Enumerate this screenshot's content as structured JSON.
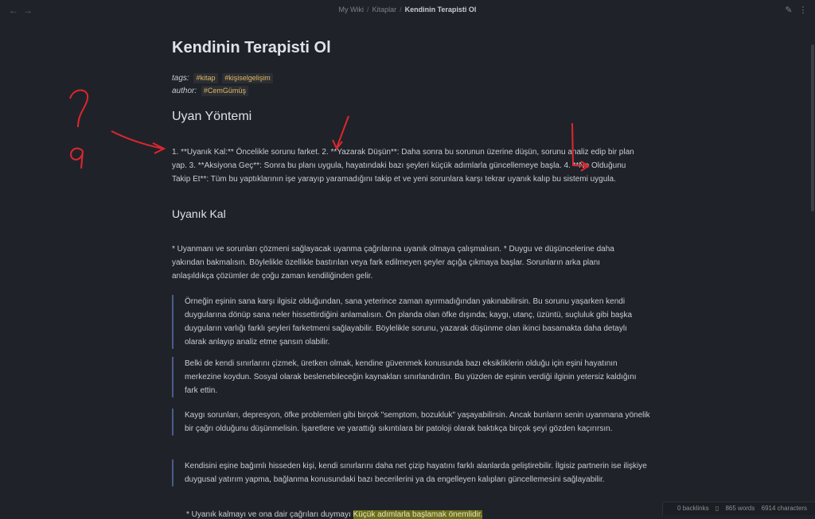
{
  "header": {
    "breadcrumb": [
      "My Wiki",
      "Kitaplar",
      "Kendinin Terapisti Ol"
    ],
    "back_icon": "arrow-left-icon",
    "forward_icon": "arrow-right-icon",
    "edit_icon": "pencil-icon",
    "more_icon": "more-options-icon"
  },
  "note": {
    "title": "Kendinin Terapisti Ol",
    "tags_key": "tags",
    "tags": [
      "#kitap",
      "#kişiselgelişim"
    ],
    "author_key": "author",
    "author": "#CemGümüş",
    "section1": {
      "heading": "Uyan Yöntemi",
      "text": "1. **Uyanık Kal:** Öncelikle sorunu farket. 2. **Yazarak Düşün**: Daha sonra bu sorunun üzerine düşün, sorunu analiz edip bir plan yap. 3. **Aksiyona Geç**: Sonra bu planı uygula, hayatındaki bazı şeyleri küçük adımlarla güncellemeye başla. 4. **Ne Olduğunu Takip Et**: Tüm bu yaptıklarının işe yarayıp yaramadığını takip et ve yeni sorunlara karşı tekrar uyanık kalıp bu sistemi uygula."
    },
    "section2": {
      "heading": "Uyanık Kal",
      "text": "* Uyanmanı ve sorunları çözmeni sağlayacak uyanma çağrılarına uyanık olmaya çalışmalısın. * Duygu ve düşüncelerine daha yakından bakmalısın. Böylelikle özellikle bastırılan veya fark edilmeyen şeyler açığa çıkmaya başlar. Sorunların arka planı anlaşıldıkça çözümler de çoğu zaman kendiliğinden gelir.",
      "quotes": [
        "Örneğin eşinin sana karşı ilgisiz olduğundan, sana yeterince zaman ayırmadığından yakınabilirsin. Bu sorunu yaşarken kendi duygularına dönüp sana neler hissettirdiğini anlamalısın. Ön planda olan öfke dışında; kaygı, utanç, üzüntü, suçluluk gibi başka duyguların varlığı farklı şeyleri farketmeni sağlayabilir. Böylelikle sorunu, yazarak düşünme olan ikinci basamakta daha detaylı olarak anlayıp analiz etme şansın olabilir.",
        "Belki de kendi sınırlarını çizmek, üretken olmak, kendine güvenmek konusunda bazı eksikliklerin olduğu için eşini hayatının merkezine koydun. Sosyal olarak beslenebileceğin kaynakları sınırlandırdın. Bu yüzden de eşinin verdiği ilginin yetersiz kaldığını fark ettin.",
        "Kaygı sorunları, depresyon, öfke problemleri gibi birçok \"semptom, bozukluk\" yaşayabilirsin. Ancak bunların senin uyanmana yönelik bir çağrı olduğunu düşünmelisin. İşaretlere ve yarattığı sıkıntılara bir patoloji olarak baktıkça birçok şeyi gözden kaçırırsın.",
        "Kendisini eşine bağımlı hisseden kişi, kendi sınırlarını daha net çizip hayatını farklı alanlarda geliştirebilir. İlgisiz partnerin ise ilişkiye duygusal yatırım yapma, bağlanma konusundaki bazı becerilerini ya da engelleyen kalıpları güncellemesini sağlayabilir."
      ]
    },
    "last_line_prefix": "* Uyanık kalmayı ve ona dair çağrıları duymayı",
    "last_line_highlight": "Küçük adımlarla başlamak önemlidir."
  },
  "status": {
    "backlinks": "0 backlinks",
    "words": "865 words",
    "characters": "6914 characters",
    "backlinks_icon": "book-icon"
  },
  "colors": {
    "background": "#1f2329",
    "tag_text": "#e2b864",
    "quote_border": "#4a5a8c",
    "annotation": "#e0262e",
    "highlight": "#6b6e19"
  }
}
